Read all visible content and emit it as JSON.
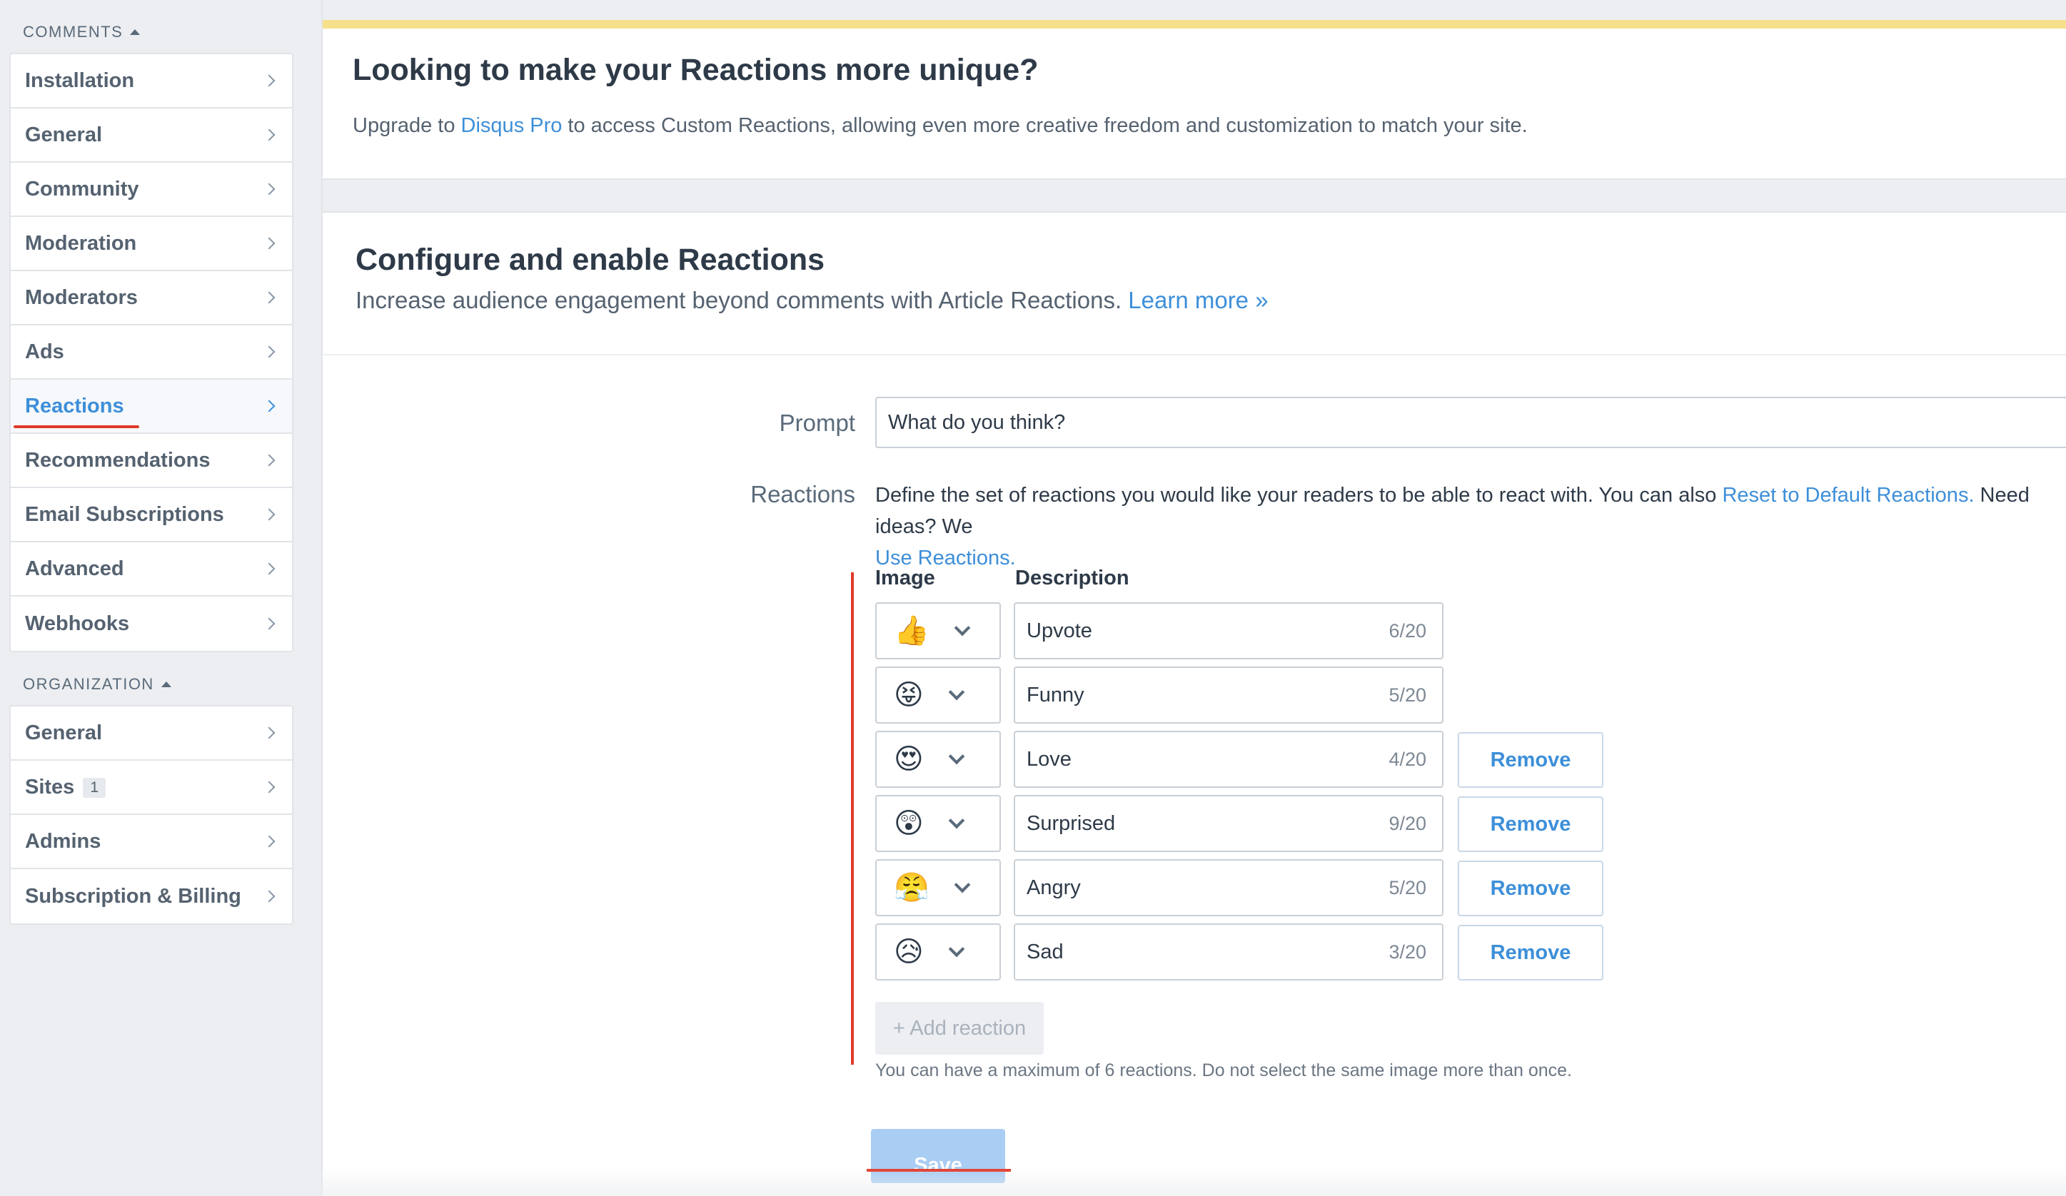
{
  "sidebar": {
    "comments_heading": "COMMENTS",
    "comments_items": [
      {
        "label": "Installation"
      },
      {
        "label": "General"
      },
      {
        "label": "Community"
      },
      {
        "label": "Moderation"
      },
      {
        "label": "Moderators"
      },
      {
        "label": "Ads"
      },
      {
        "label": "Reactions",
        "active": true
      },
      {
        "label": "Recommendations"
      },
      {
        "label": "Email Subscriptions"
      },
      {
        "label": "Advanced"
      },
      {
        "label": "Webhooks"
      }
    ],
    "organization_heading": "ORGANIZATION",
    "organization_items": [
      {
        "label": "General"
      },
      {
        "label": "Sites",
        "badge": "1"
      },
      {
        "label": "Admins"
      },
      {
        "label": "Subscription & Billing"
      }
    ]
  },
  "upsell": {
    "title": "Looking to make your Reactions more unique?",
    "text_before": "Upgrade to ",
    "link": "Disqus Pro",
    "text_after": " to access Custom Reactions, allowing even more creative freedom and customization to match your site."
  },
  "config": {
    "title": "Configure and enable Reactions",
    "subtitle": "Increase audience engagement beyond comments with Article Reactions. ",
    "learn_more": "Learn more »",
    "prompt_label": "Prompt",
    "prompt_value": "What do you think?",
    "reactions_label": "Reactions",
    "description_before": "Define the set of reactions you would like your readers to be able to react with. You can also ",
    "reset_link": "Reset to Default Reactions.",
    "description_after": " Need ideas? We",
    "use_link": "Use Reactions.",
    "image_header": "Image",
    "description_header": "Description",
    "reactions": [
      {
        "emoji": "👍",
        "icon": "thumbs-up-emoji",
        "text": "Upvote",
        "count": "6/20",
        "removable": false
      },
      {
        "emoji": "😝",
        "icon": "tongue-emoji",
        "text": "Funny",
        "count": "5/20",
        "removable": false
      },
      {
        "emoji": "😍",
        "icon": "heart-eyes-emoji",
        "text": "Love",
        "count": "4/20",
        "removable": true
      },
      {
        "emoji": "😲",
        "icon": "surprised-emoji",
        "text": "Surprised",
        "count": "9/20",
        "removable": true
      },
      {
        "emoji": "😤",
        "icon": "angry-emoji",
        "text": "Angry",
        "count": "5/20",
        "removable": true
      },
      {
        "emoji": "😥",
        "icon": "sad-emoji",
        "text": "Sad",
        "count": "3/20",
        "removable": true
      }
    ],
    "remove_label": "Remove",
    "add_label": "+ Add reaction",
    "hint": "You can have a maximum of 6 reactions. Do not select the same image more than once.",
    "save_label": "Save"
  },
  "colors": {
    "accent": "#3d8fd9",
    "annotation_red": "#e03a2a",
    "banner_yellow": "#f6e08c"
  }
}
